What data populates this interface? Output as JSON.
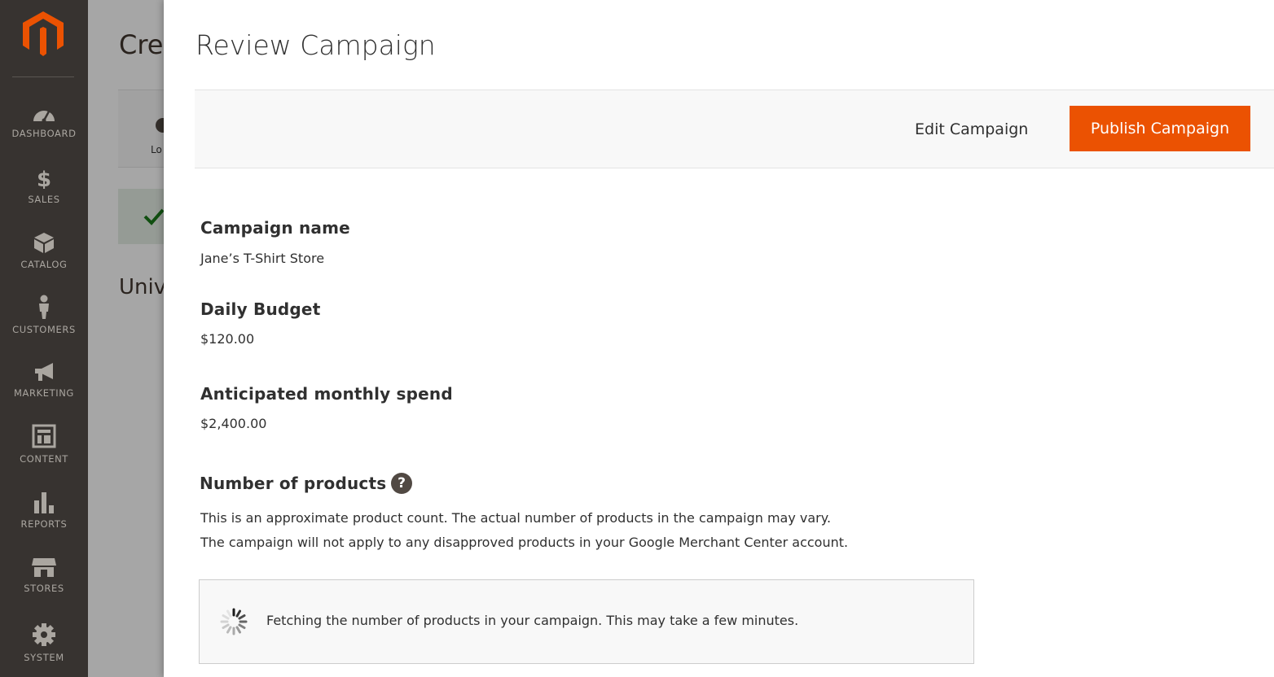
{
  "sidebar": {
    "logo": "magento-logo",
    "items": [
      {
        "label": "DASHBOARD",
        "icon": "dashboard-icon"
      },
      {
        "label": "SALES",
        "icon": "dollar-icon"
      },
      {
        "label": "CATALOG",
        "icon": "box-icon"
      },
      {
        "label": "CUSTOMERS",
        "icon": "person-icon"
      },
      {
        "label": "MARKETING",
        "icon": "megaphone-icon"
      },
      {
        "label": "CONTENT",
        "icon": "layout-icon"
      },
      {
        "label": "REPORTS",
        "icon": "bar-chart-icon"
      },
      {
        "label": "STORES",
        "icon": "storefront-icon"
      },
      {
        "label": "SYSTEM",
        "icon": "gear-icon"
      }
    ]
  },
  "background_page": {
    "title": "Cre",
    "step_text": "Lo",
    "subtitle": "Univ"
  },
  "modal": {
    "title": "Review Campaign",
    "actions": {
      "edit_label": "Edit Campaign",
      "publish_label": "Publish Campaign"
    },
    "fields": {
      "campaign_name": {
        "label": "Campaign name",
        "value": "Jane’s T-Shirt Store"
      },
      "daily_budget": {
        "label": "Daily Budget",
        "value": "$120.00"
      },
      "monthly_spend": {
        "label": "Anticipated monthly spend",
        "value": "$2,400.00"
      },
      "products": {
        "label": "Number of products",
        "help": "?",
        "note_1": "This is an approximate product count. The actual number of products in the campaign may vary.",
        "note_2": "The campaign will not apply to any disapproved products in your Google Merchant Center account.",
        "loading_text": "Fetching the number of products in your campaign. This may take a few minutes."
      }
    }
  },
  "colors": {
    "sidebar_bg": "#373330",
    "accent": "#eb5202",
    "text": "#303030"
  }
}
